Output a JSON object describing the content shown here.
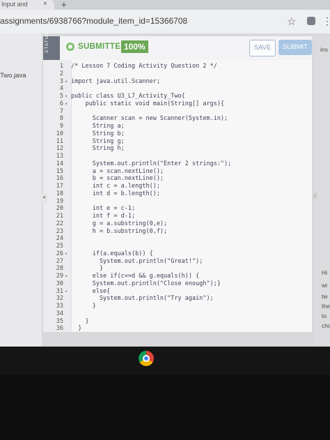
{
  "browser": {
    "tab_title": "Input and",
    "tab_close": "×",
    "new_tab": "+",
    "url": "assignments/6938766?module_item_id=15366708"
  },
  "left_nav": {
    "file_label": "Two.java"
  },
  "status_label": "STATUS",
  "header": {
    "submitted_label": "SUBMITTED",
    "score": "100%",
    "save_label": "SAVE",
    "submit_label": "SUBMIT"
  },
  "right_panel": {
    "fragments": [
      "ins",
      "Hi",
      "wi",
      "tw",
      "the",
      "to",
      "cho"
    ]
  },
  "editor": {
    "lines": [
      {
        "n": "1",
        "fold": "",
        "code": "/* Lesson 7 Coding Activity Question 2 */"
      },
      {
        "n": "2",
        "fold": "",
        "code": ""
      },
      {
        "n": "3",
        "fold": "▾",
        "code": "import java.util.Scanner;"
      },
      {
        "n": "4",
        "fold": "",
        "code": ""
      },
      {
        "n": "5",
        "fold": "▾",
        "code": "public class U3_L7_Activity_Two{"
      },
      {
        "n": "6",
        "fold": "▾",
        "code": "    public static void main(String[] args){"
      },
      {
        "n": "7",
        "fold": "",
        "code": ""
      },
      {
        "n": "8",
        "fold": "",
        "code": "      Scanner scan = new Scanner(System.in);"
      },
      {
        "n": "9",
        "fold": "",
        "code": "      String a;"
      },
      {
        "n": "10",
        "fold": "",
        "code": "      String b;"
      },
      {
        "n": "11",
        "fold": "",
        "code": "      String g;"
      },
      {
        "n": "12",
        "fold": "",
        "code": "      String h;"
      },
      {
        "n": "13",
        "fold": "",
        "code": ""
      },
      {
        "n": "14",
        "fold": "",
        "code": "      System.out.println(\"Enter 2 strings:\");"
      },
      {
        "n": "15",
        "fold": "",
        "code": "      a = scan.nextLine();"
      },
      {
        "n": "16",
        "fold": "",
        "code": "      b = scan.nextLine();"
      },
      {
        "n": "17",
        "fold": "",
        "code": "      int c = a.length();"
      },
      {
        "n": "18",
        "fold": "",
        "code": "      int d = b.length();"
      },
      {
        "n": "19",
        "fold": "",
        "code": ""
      },
      {
        "n": "20",
        "fold": "",
        "code": "      int e = c-1;"
      },
      {
        "n": "21",
        "fold": "",
        "code": "      int f = d-1;"
      },
      {
        "n": "22",
        "fold": "",
        "code": "      g = a.substring(0,e);"
      },
      {
        "n": "23",
        "fold": "",
        "code": "      h = b.substring(0,f);"
      },
      {
        "n": "24",
        "fold": "",
        "code": ""
      },
      {
        "n": "25",
        "fold": "",
        "code": ""
      },
      {
        "n": "26",
        "fold": "▾",
        "code": "      if(a.equals(b)) {"
      },
      {
        "n": "27",
        "fold": "",
        "code": "        System.out.println(\"Great!\");"
      },
      {
        "n": "28",
        "fold": "",
        "code": "        }"
      },
      {
        "n": "29",
        "fold": "▾",
        "code": "      else if(c==d && g.equals(h)) {"
      },
      {
        "n": "30",
        "fold": "",
        "code": "      System.out.println(\"Close enough\");}"
      },
      {
        "n": "31",
        "fold": "▾",
        "code": "      else{"
      },
      {
        "n": "32",
        "fold": "",
        "code": "        System.out.println(\"Try again\");"
      },
      {
        "n": "33",
        "fold": "",
        "code": "      }"
      },
      {
        "n": "34",
        "fold": "",
        "code": ""
      },
      {
        "n": "35",
        "fold": "",
        "code": "    }"
      },
      {
        "n": "36",
        "fold": "",
        "code": "  }"
      }
    ]
  }
}
